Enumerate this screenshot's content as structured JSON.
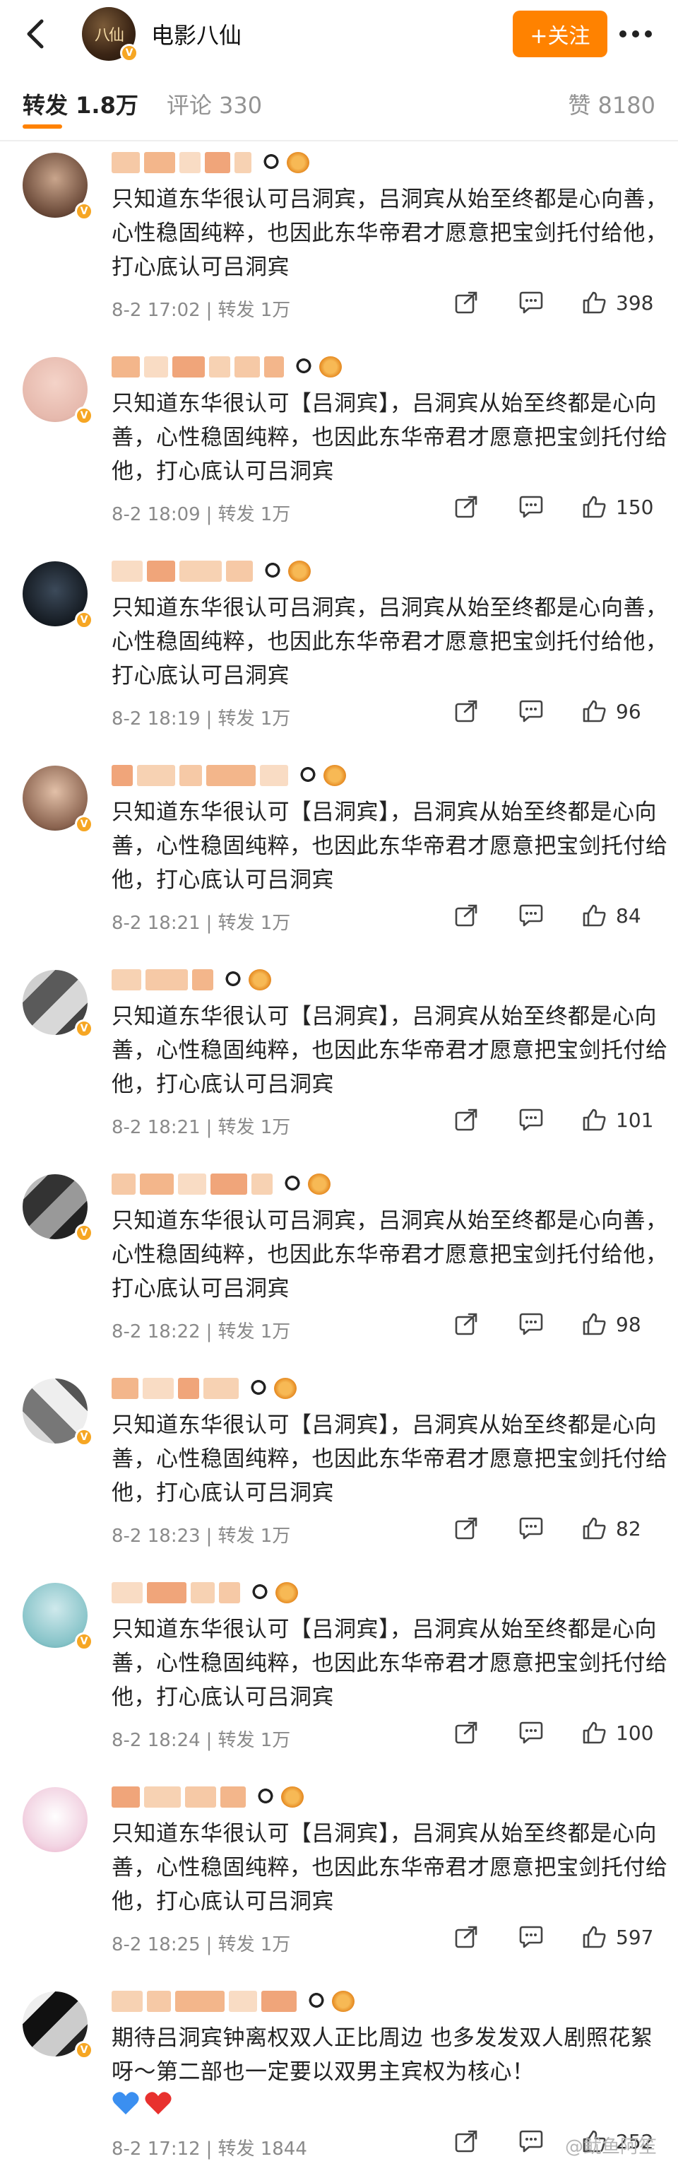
{
  "header": {
    "title": "电影八仙",
    "avatar_text": "八仙",
    "follow_label": "+关注"
  },
  "tabs": {
    "reposts": "转发 1.8万",
    "comments": "评论 330",
    "likes": "赞 8180"
  },
  "colors": {
    "accent": "#ff8200",
    "verified": "#f6a623",
    "heart_blue": "#3b8ff0",
    "heart_red": "#e8312e"
  },
  "comments": [
    {
      "text": "只知道东华很认可吕洞宾，吕洞宾从始至终都是心向善，心性稳固纯粹，也因此东华帝君才愿意把宝剑托付给他，打心底认可吕洞宾",
      "date": "8-2 17:02",
      "repost": "转发 1万",
      "likes": "398"
    },
    {
      "text": "只知道东华很认可【吕洞宾】，吕洞宾从始至终都是心向善，心性稳固纯粹，也因此东华帝君才愿意把宝剑托付给他，打心底认可吕洞宾",
      "date": "8-2 18:09",
      "repost": "转发 1万",
      "likes": "150"
    },
    {
      "text": "只知道东华很认可吕洞宾，吕洞宾从始至终都是心向善，心性稳固纯粹，也因此东华帝君才愿意把宝剑托付给他，打心底认可吕洞宾",
      "date": "8-2 18:19",
      "repost": "转发 1万",
      "likes": "96"
    },
    {
      "text": "只知道东华很认可【吕洞宾】，吕洞宾从始至终都是心向善，心性稳固纯粹，也因此东华帝君才愿意把宝剑托付给他，打心底认可吕洞宾",
      "date": "8-2 18:21",
      "repost": "转发 1万",
      "likes": "84"
    },
    {
      "text": "只知道东华很认可【吕洞宾】，吕洞宾从始至终都是心向善，心性稳固纯粹，也因此东华帝君才愿意把宝剑托付给他，打心底认可吕洞宾",
      "date": "8-2 18:21",
      "repost": "转发 1万",
      "likes": "101"
    },
    {
      "text": "只知道东华很认可吕洞宾，吕洞宾从始至终都是心向善，心性稳固纯粹，也因此东华帝君才愿意把宝剑托付给他，打心底认可吕洞宾",
      "date": "8-2 18:22",
      "repost": "转发 1万",
      "likes": "98"
    },
    {
      "text": "只知道东华很认可【吕洞宾】，吕洞宾从始至终都是心向善，心性稳固纯粹，也因此东华帝君才愿意把宝剑托付给他，打心底认可吕洞宾",
      "date": "8-2 18:23",
      "repost": "转发 1万",
      "likes": "82"
    },
    {
      "text": "只知道东华很认可【吕洞宾】，吕洞宾从始至终都是心向善，心性稳固纯粹，也因此东华帝君才愿意把宝剑托付给他，打心底认可吕洞宾",
      "date": "8-2 18:24",
      "repost": "转发 1万",
      "likes": "100"
    },
    {
      "text": "只知道东华很认可【吕洞宾】，吕洞宾从始至终都是心向善，心性稳固纯粹，也因此东华帝君才愿意把宝剑托付给他，打心底认可吕洞宾",
      "date": "8-2 18:25",
      "repost": "转发 1万",
      "likes": "597"
    },
    {
      "text": "期待吕洞宾钟离权双人正比周边 也多发发双人剧照花絮呀～第二部也一定要以双男主宾权为核心！",
      "date": "8-2 17:12",
      "repost": "转发 1844",
      "likes": "252"
    }
  ],
  "watermark": "@鱿鱼阿笙"
}
